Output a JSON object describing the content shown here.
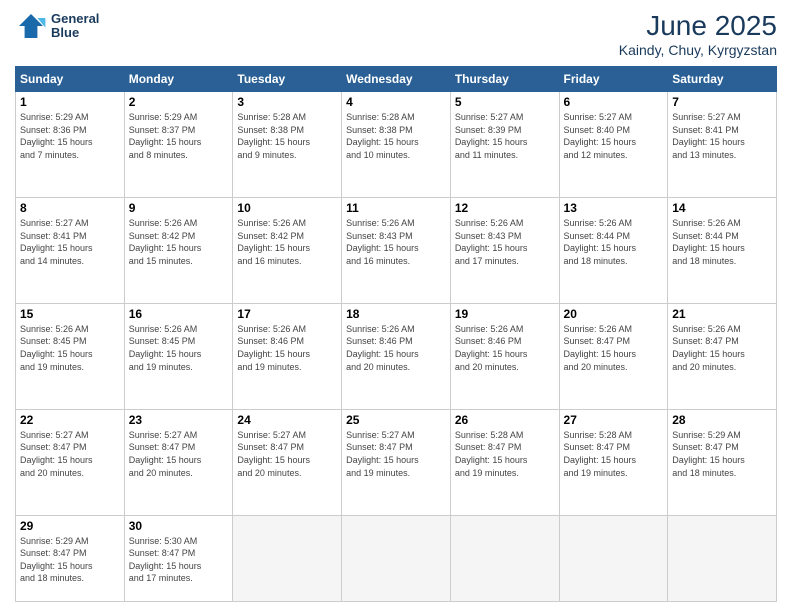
{
  "header": {
    "logo_line1": "General",
    "logo_line2": "Blue",
    "title": "June 2025",
    "subtitle": "Kaindy, Chuy, Kyrgyzstan"
  },
  "weekdays": [
    "Sunday",
    "Monday",
    "Tuesday",
    "Wednesday",
    "Thursday",
    "Friday",
    "Saturday"
  ],
  "weeks": [
    [
      {
        "day": "1",
        "info": "Sunrise: 5:29 AM\nSunset: 8:36 PM\nDaylight: 15 hours\nand 7 minutes."
      },
      {
        "day": "2",
        "info": "Sunrise: 5:29 AM\nSunset: 8:37 PM\nDaylight: 15 hours\nand 8 minutes."
      },
      {
        "day": "3",
        "info": "Sunrise: 5:28 AM\nSunset: 8:38 PM\nDaylight: 15 hours\nand 9 minutes."
      },
      {
        "day": "4",
        "info": "Sunrise: 5:28 AM\nSunset: 8:38 PM\nDaylight: 15 hours\nand 10 minutes."
      },
      {
        "day": "5",
        "info": "Sunrise: 5:27 AM\nSunset: 8:39 PM\nDaylight: 15 hours\nand 11 minutes."
      },
      {
        "day": "6",
        "info": "Sunrise: 5:27 AM\nSunset: 8:40 PM\nDaylight: 15 hours\nand 12 minutes."
      },
      {
        "day": "7",
        "info": "Sunrise: 5:27 AM\nSunset: 8:41 PM\nDaylight: 15 hours\nand 13 minutes."
      }
    ],
    [
      {
        "day": "8",
        "info": "Sunrise: 5:27 AM\nSunset: 8:41 PM\nDaylight: 15 hours\nand 14 minutes."
      },
      {
        "day": "9",
        "info": "Sunrise: 5:26 AM\nSunset: 8:42 PM\nDaylight: 15 hours\nand 15 minutes."
      },
      {
        "day": "10",
        "info": "Sunrise: 5:26 AM\nSunset: 8:42 PM\nDaylight: 15 hours\nand 16 minutes."
      },
      {
        "day": "11",
        "info": "Sunrise: 5:26 AM\nSunset: 8:43 PM\nDaylight: 15 hours\nand 16 minutes."
      },
      {
        "day": "12",
        "info": "Sunrise: 5:26 AM\nSunset: 8:43 PM\nDaylight: 15 hours\nand 17 minutes."
      },
      {
        "day": "13",
        "info": "Sunrise: 5:26 AM\nSunset: 8:44 PM\nDaylight: 15 hours\nand 18 minutes."
      },
      {
        "day": "14",
        "info": "Sunrise: 5:26 AM\nSunset: 8:44 PM\nDaylight: 15 hours\nand 18 minutes."
      }
    ],
    [
      {
        "day": "15",
        "info": "Sunrise: 5:26 AM\nSunset: 8:45 PM\nDaylight: 15 hours\nand 19 minutes."
      },
      {
        "day": "16",
        "info": "Sunrise: 5:26 AM\nSunset: 8:45 PM\nDaylight: 15 hours\nand 19 minutes."
      },
      {
        "day": "17",
        "info": "Sunrise: 5:26 AM\nSunset: 8:46 PM\nDaylight: 15 hours\nand 19 minutes."
      },
      {
        "day": "18",
        "info": "Sunrise: 5:26 AM\nSunset: 8:46 PM\nDaylight: 15 hours\nand 20 minutes."
      },
      {
        "day": "19",
        "info": "Sunrise: 5:26 AM\nSunset: 8:46 PM\nDaylight: 15 hours\nand 20 minutes."
      },
      {
        "day": "20",
        "info": "Sunrise: 5:26 AM\nSunset: 8:47 PM\nDaylight: 15 hours\nand 20 minutes."
      },
      {
        "day": "21",
        "info": "Sunrise: 5:26 AM\nSunset: 8:47 PM\nDaylight: 15 hours\nand 20 minutes."
      }
    ],
    [
      {
        "day": "22",
        "info": "Sunrise: 5:27 AM\nSunset: 8:47 PM\nDaylight: 15 hours\nand 20 minutes."
      },
      {
        "day": "23",
        "info": "Sunrise: 5:27 AM\nSunset: 8:47 PM\nDaylight: 15 hours\nand 20 minutes."
      },
      {
        "day": "24",
        "info": "Sunrise: 5:27 AM\nSunset: 8:47 PM\nDaylight: 15 hours\nand 20 minutes."
      },
      {
        "day": "25",
        "info": "Sunrise: 5:27 AM\nSunset: 8:47 PM\nDaylight: 15 hours\nand 19 minutes."
      },
      {
        "day": "26",
        "info": "Sunrise: 5:28 AM\nSunset: 8:47 PM\nDaylight: 15 hours\nand 19 minutes."
      },
      {
        "day": "27",
        "info": "Sunrise: 5:28 AM\nSunset: 8:47 PM\nDaylight: 15 hours\nand 19 minutes."
      },
      {
        "day": "28",
        "info": "Sunrise: 5:29 AM\nSunset: 8:47 PM\nDaylight: 15 hours\nand 18 minutes."
      }
    ],
    [
      {
        "day": "29",
        "info": "Sunrise: 5:29 AM\nSunset: 8:47 PM\nDaylight: 15 hours\nand 18 minutes."
      },
      {
        "day": "30",
        "info": "Sunrise: 5:30 AM\nSunset: 8:47 PM\nDaylight: 15 hours\nand 17 minutes."
      },
      {
        "day": "",
        "info": ""
      },
      {
        "day": "",
        "info": ""
      },
      {
        "day": "",
        "info": ""
      },
      {
        "day": "",
        "info": ""
      },
      {
        "day": "",
        "info": ""
      }
    ]
  ]
}
